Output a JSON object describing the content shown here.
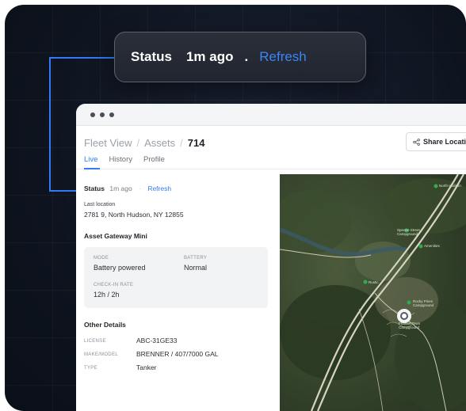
{
  "status_pill": {
    "label": "Status",
    "ago": "1m ago",
    "separator": ".",
    "refresh": "Refresh"
  },
  "breadcrumb": {
    "root": "Fleet View",
    "section": "Assets",
    "current": "714"
  },
  "share_button": "Share Location",
  "tabs": [
    {
      "label": "Live",
      "active": true
    },
    {
      "label": "History",
      "active": false
    },
    {
      "label": "Profile",
      "active": false
    }
  ],
  "status": {
    "label": "Status",
    "ago": "1m ago",
    "separator": "·",
    "refresh": "Refresh"
  },
  "last_location": {
    "label": "Last location",
    "value": "2781 9, North Hudson, NY 12855"
  },
  "gateway": {
    "title": "Asset Gateway Mini",
    "mode_label": "MODE",
    "mode_value": "Battery powered",
    "battery_label": "BATTERY",
    "battery_value": "Normal",
    "checkin_label": "CHECK-IN RATE",
    "checkin_value": "12h / 2h"
  },
  "other_details": {
    "title": "Other Details",
    "rows": [
      {
        "key": "LICENSE",
        "value": "ABC-31GE33"
      },
      {
        "key": "MAKE/MODEL",
        "value": "BRENNER / 407/7000 GAL"
      },
      {
        "key": "TYPE",
        "value": "Tanker"
      }
    ]
  },
  "map": {
    "labels": [
      "Spectre Street Campground",
      "Amenities",
      "Rustic",
      "Rocky Pines Campground",
      "North Hudson",
      "Frontier Town Campground"
    ]
  },
  "colors": {
    "accent": "#2f7cf6",
    "background": "#0e141f"
  }
}
